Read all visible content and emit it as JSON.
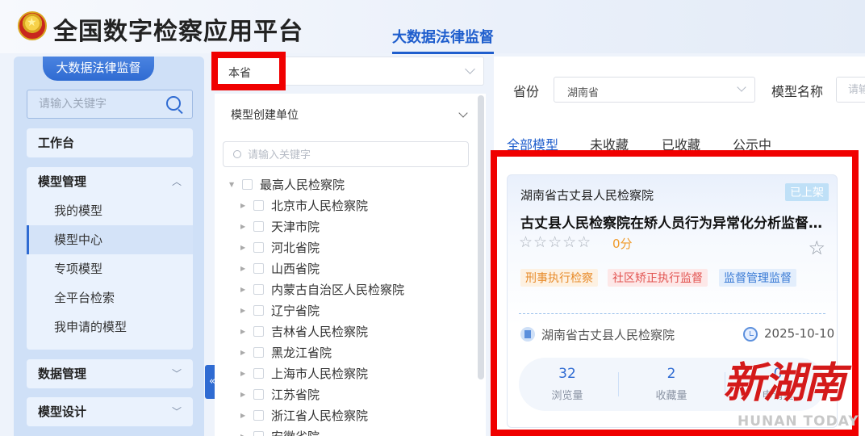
{
  "header": {
    "app_title": "全国数字检察应用平台",
    "top_tab": "大数据法律监督"
  },
  "sidebar": {
    "pill": "大数据法律监督",
    "search_placeholder": "请输入关键字",
    "workbench": "工作台",
    "model_mgmt": {
      "title": "模型管理",
      "items": [
        "我的模型",
        "模型中心",
        "专项模型",
        "全平台检索",
        "我申请的模型"
      ]
    },
    "data_mgmt": "数据管理",
    "model_design": "模型设计"
  },
  "filter": {
    "scope_value": "本省",
    "unit_label": "模型创建单位",
    "unit_search_placeholder": "请输入关键字",
    "tree": [
      "最高人民检察院",
      "北京市人民检察院",
      "天津市院",
      "河北省院",
      "山西省院",
      "内蒙古自治区人民检察院",
      "辽宁省院",
      "吉林省人民检察院",
      "黑龙江省院",
      "上海市人民检察院",
      "江苏省院",
      "浙江省人民检察院",
      "安徽省院"
    ]
  },
  "query": {
    "province_label": "省份",
    "province_value": "湖南省",
    "model_name_label": "模型名称",
    "model_name_placeholder": "请输"
  },
  "tabs": [
    "全部模型",
    "未收藏",
    "已收藏",
    "公示中"
  ],
  "card": {
    "org": "湖南省古丈县人民检察院",
    "badge": "已上架",
    "title": "古丈县人民检察院在矫人员行为异常化分析监督模型",
    "stars": "☆☆☆☆☆",
    "rating": 0,
    "score": "0分",
    "tags": [
      "刑事执行检察",
      "社区矫正执行监督",
      "监督管理监督"
    ],
    "unit": "湖南省古丈县人民检察院",
    "date": "2025-10-10",
    "stats": [
      {
        "num": "32",
        "label": "浏览量"
      },
      {
        "num": "2",
        "label": "收藏量"
      },
      {
        "num": "0",
        "label": "申请量"
      }
    ]
  },
  "watermark": {
    "cn": "新湖南",
    "en": "HUNAN TODAY"
  },
  "colors": {
    "accent": "#2f6bd2",
    "highlight_box": "#f00000"
  }
}
